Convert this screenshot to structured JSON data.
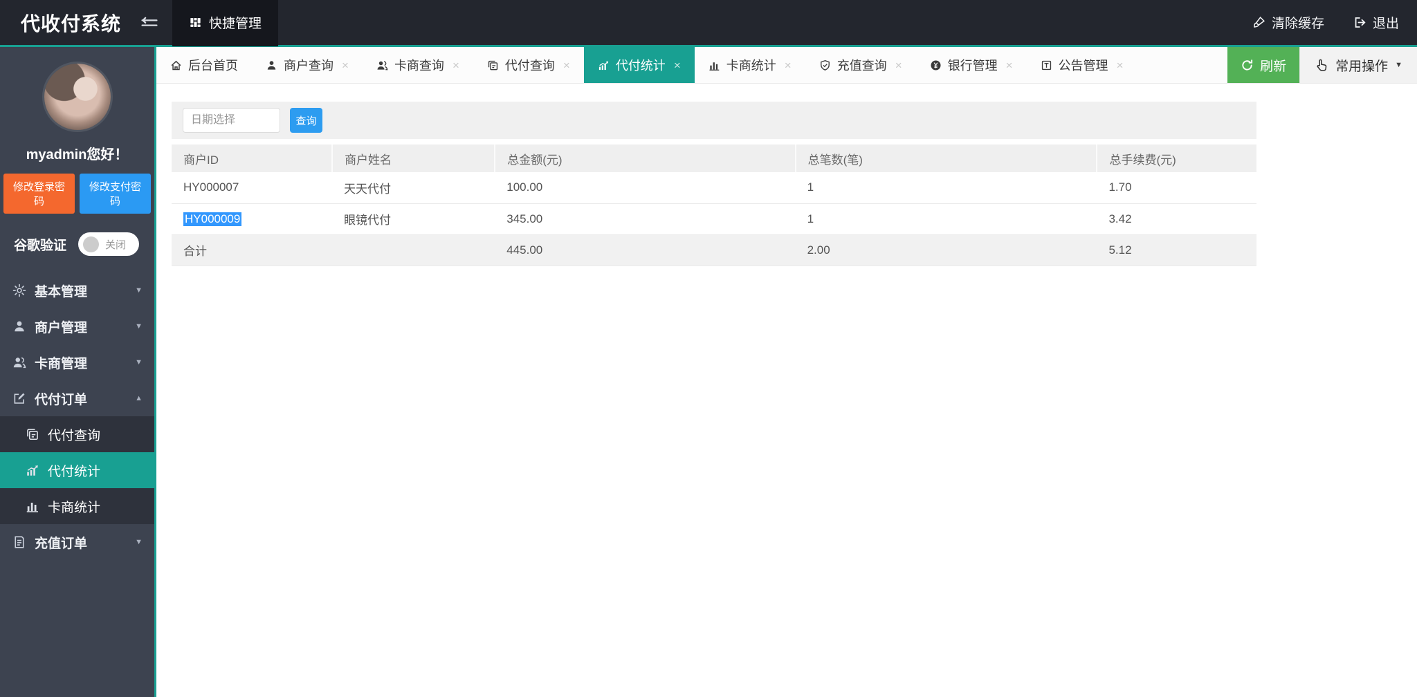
{
  "topbar": {
    "title": "代收付系统",
    "quick_manage": "快捷管理",
    "clear_cache": "清除缓存",
    "logout": "退出"
  },
  "sidebar": {
    "greeting": "myadmin您好！",
    "change_login_pwd": "修改登录密码",
    "change_pay_pwd": "修改支付密码",
    "google_auth": {
      "label": "谷歌验证",
      "state": "关闭"
    },
    "menu": [
      {
        "label": "基本管理",
        "icon": "gear-icon",
        "state": "collapsed"
      },
      {
        "label": "商户管理",
        "icon": "merchant-icon",
        "state": "collapsed"
      },
      {
        "label": "卡商管理",
        "icon": "card-dealer-icon",
        "state": "collapsed"
      },
      {
        "label": "代付订单",
        "icon": "payout-order-icon",
        "state": "expanded",
        "children": [
          {
            "label": "代付查询",
            "icon": "payout-query-icon",
            "active": false
          },
          {
            "label": "代付统计",
            "icon": "payout-stats-icon",
            "active": true
          },
          {
            "label": "卡商统计",
            "icon": "dealer-stats-icon",
            "active": false
          }
        ]
      },
      {
        "label": "充值订单",
        "icon": "recharge-order-icon",
        "state": "collapsed"
      }
    ]
  },
  "tabbar": {
    "tabs": [
      {
        "label": "后台首页",
        "icon": "home-icon",
        "closable": false,
        "active": false
      },
      {
        "label": "商户查询",
        "icon": "merchant-icon",
        "closable": true,
        "active": false
      },
      {
        "label": "卡商查询",
        "icon": "card-dealer-icon",
        "closable": true,
        "active": false
      },
      {
        "label": "代付查询",
        "icon": "payout-query-icon",
        "closable": true,
        "active": false
      },
      {
        "label": "代付统计",
        "icon": "payout-stats-icon",
        "closable": true,
        "active": true
      },
      {
        "label": "卡商统计",
        "icon": "dealer-stats-icon",
        "closable": true,
        "active": false
      },
      {
        "label": "充值查询",
        "icon": "shield-check-icon",
        "closable": true,
        "active": false
      },
      {
        "label": "银行管理",
        "icon": "yen-circle-icon",
        "closable": true,
        "active": false
      },
      {
        "label": "公告管理",
        "icon": "notice-icon",
        "closable": true,
        "active": false
      }
    ],
    "refresh": "刷新",
    "common_ops": "常用操作"
  },
  "search": {
    "date_placeholder": "日期选择",
    "query": "查询"
  },
  "table": {
    "headers": [
      "商户ID",
      "商户姓名",
      "总金额(元)",
      "总笔数(笔)",
      "总手续费(元)"
    ],
    "col_widths": [
      "14.8%",
      "15.0%",
      "27.7%",
      "27.8%",
      "14.7%"
    ],
    "rows": [
      {
        "cells": [
          "HY000007",
          "天天代付",
          "100.00",
          "1",
          "1.70"
        ],
        "selected_cell": -1,
        "is_total": false
      },
      {
        "cells": [
          "HY000009",
          "眼镜代付",
          "345.00",
          "1",
          "3.42"
        ],
        "selected_cell": 0,
        "is_total": false
      },
      {
        "cells": [
          "合计",
          "",
          "445.00",
          "2.00",
          "5.12"
        ],
        "selected_cell": -1,
        "is_total": true
      }
    ]
  },
  "colors": {
    "accent_teal": "#18a092",
    "topbar_bg": "#23262e",
    "quick_block_bg": "#15171d",
    "sidebar_bg": "#3d4350",
    "submenu_bg": "#2e323c",
    "orange_button": "#f4682e",
    "blue_button": "#2b9af3",
    "query_button": "#2d9cf0",
    "refresh_green": "#53b156",
    "selection_blue": "#3297fd"
  }
}
